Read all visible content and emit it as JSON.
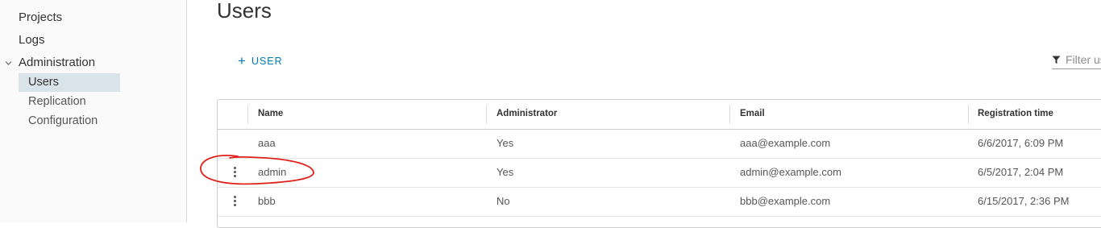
{
  "sidebar": {
    "items": [
      {
        "label": "Projects"
      },
      {
        "label": "Logs"
      },
      {
        "label": "Administration",
        "expanded": true,
        "children": [
          {
            "label": "Users",
            "active": true
          },
          {
            "label": "Replication"
          },
          {
            "label": "Configuration"
          }
        ]
      }
    ]
  },
  "main": {
    "title": "Users",
    "add_user_label": "USER",
    "filter": {
      "placeholder": "Filter users",
      "icon": "filter-icon"
    },
    "accent_color": "#0079b8",
    "table": {
      "columns": [
        "Name",
        "Administrator",
        "Email",
        "Registration time"
      ],
      "rows": [
        {
          "name": "aaa",
          "admin": "Yes",
          "email": "aaa@example.com",
          "registered": "6/6/2017, 6:09 PM"
        },
        {
          "name": "admin",
          "admin": "Yes",
          "email": "admin@example.com",
          "registered": "6/5/2017, 2:04 PM"
        },
        {
          "name": "bbb",
          "admin": "No",
          "email": "bbb@example.com",
          "registered": "6/15/2017, 2:36 PM"
        }
      ]
    },
    "annotation_color": "#e0201a"
  }
}
